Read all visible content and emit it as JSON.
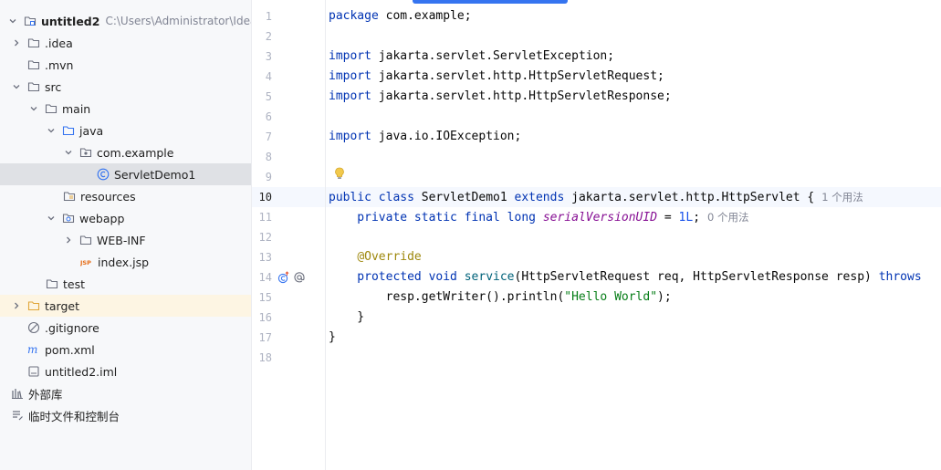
{
  "project": {
    "name": "untitled2",
    "path": "C:\\Users\\Administrator\\IdeaPro"
  },
  "tree": [
    {
      "label": "untitled2",
      "extra": "C:\\Users\\Administrator\\IdeaPro",
      "icon": "project-folder-icon",
      "chevron": "down",
      "depth": 0
    },
    {
      "label": ".idea",
      "icon": "folder-icon",
      "chevron": "right",
      "depth": 1
    },
    {
      "label": ".mvn",
      "icon": "folder-icon",
      "chevron": "none",
      "depth": 1
    },
    {
      "label": "src",
      "icon": "folder-icon",
      "chevron": "down",
      "depth": 1
    },
    {
      "label": "main",
      "icon": "folder-icon",
      "chevron": "down",
      "depth": 2
    },
    {
      "label": "java",
      "icon": "source-folder-icon",
      "chevron": "down",
      "depth": 3
    },
    {
      "label": "com.example",
      "icon": "package-icon",
      "chevron": "down",
      "depth": 4
    },
    {
      "label": "ServletDemo1",
      "icon": "class-icon",
      "chevron": "none",
      "depth": 5
    },
    {
      "label": "resources",
      "icon": "resources-folder-icon",
      "chevron": "none",
      "depth": 3
    },
    {
      "label": "webapp",
      "icon": "web-folder-icon",
      "chevron": "down",
      "depth": 3
    },
    {
      "label": "WEB-INF",
      "icon": "folder-icon",
      "chevron": "right",
      "depth": 4
    },
    {
      "label": "index.jsp",
      "icon": "jsp-icon",
      "chevron": "none",
      "depth": 4
    },
    {
      "label": "test",
      "icon": "folder-icon",
      "chevron": "none",
      "depth": 2
    },
    {
      "label": "target",
      "icon": "excluded-folder-icon",
      "chevron": "right",
      "depth": 1
    },
    {
      "label": ".gitignore",
      "icon": "ignore-icon",
      "chevron": "none",
      "depth": 1
    },
    {
      "label": "pom.xml",
      "icon": "maven-icon",
      "chevron": "none",
      "depth": 1
    },
    {
      "label": "untitled2.iml",
      "icon": "module-file-icon",
      "chevron": "none",
      "depth": 1
    },
    {
      "label": "外部库",
      "icon": "library-icon",
      "chevron": "none",
      "depth": 0
    },
    {
      "label": "临时文件和控制台",
      "icon": "scratches-icon",
      "chevron": "none",
      "depth": 0
    }
  ],
  "editor": {
    "current_line": "10",
    "line_numbers": [
      "1",
      "2",
      "3",
      "4",
      "5",
      "6",
      "7",
      "8",
      "9",
      "10",
      "11",
      "12",
      "13",
      "14",
      "15",
      "16",
      "17",
      "18"
    ],
    "code": {
      "l1": [
        "package",
        " com.example;"
      ],
      "l3": [
        "import",
        " jakarta.servlet.ServletException;"
      ],
      "l4": [
        "import",
        " jakarta.servlet.http.HttpServletRequest;"
      ],
      "l5": [
        "import",
        " jakarta.servlet.http.HttpServletResponse;"
      ],
      "l7": [
        "import",
        " java.io.IOException;"
      ],
      "l10": [
        "public class",
        " ServletDemo1 ",
        "extends",
        " jakarta.servlet.http.HttpServlet {",
        "1 个用法"
      ],
      "l11": [
        "    private static final long ",
        "serialVersionUID",
        " = ",
        "1L",
        ";",
        "0 个用法"
      ],
      "l13": [
        "    ",
        "@Override"
      ],
      "l14": [
        "    protected void ",
        "service",
        "(HttpServletRequest req, HttpServletResponse resp) ",
        "throws"
      ],
      "l15": [
        "        resp.getWriter().println(",
        "\"Hello World\"",
        ");"
      ],
      "l16": [
        "    }"
      ],
      "l17": [
        "}"
      ]
    }
  },
  "colors": {
    "keyword": "#0033b3",
    "annotation": "#9e880d",
    "field": "#871094",
    "number": "#1750eb",
    "string": "#067d17",
    "method": "#00627a",
    "accent": "#3574f0"
  }
}
